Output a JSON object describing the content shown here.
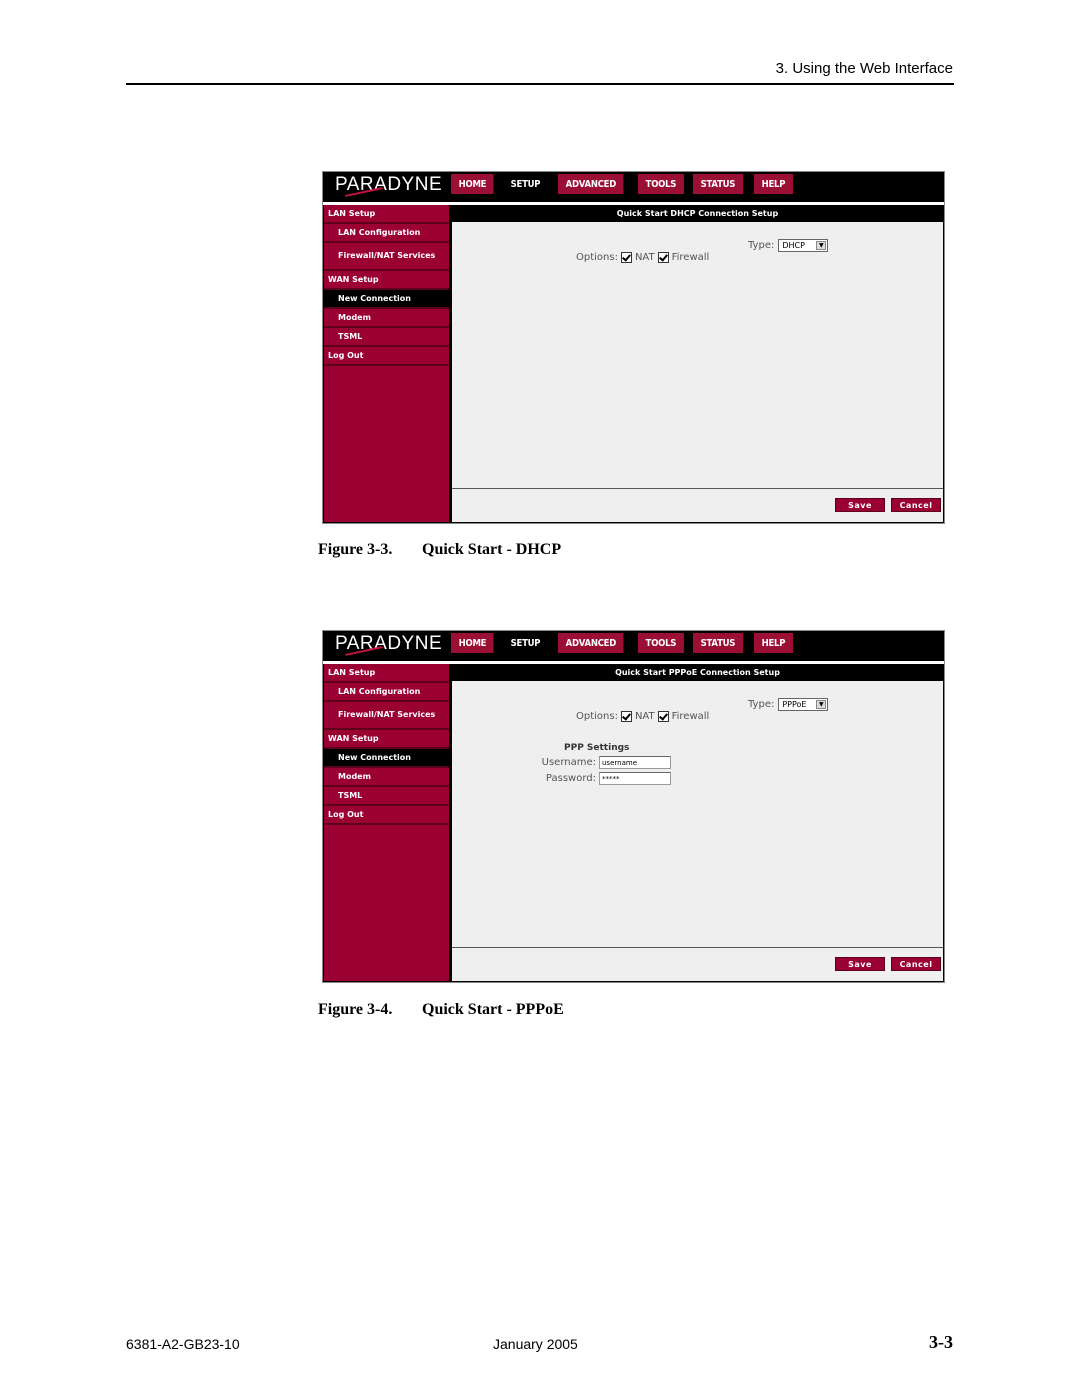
{
  "page": {
    "header": "3. Using the Web Interface",
    "footer_left": "6381-A2-GB23-10",
    "footer_center": "January 2005",
    "footer_right": "3-3"
  },
  "figures": [
    {
      "caption_number": "Figure 3-3.",
      "caption_title": "Quick Start - DHCP",
      "logo": "PARADYNE",
      "tabs": [
        "HOME",
        "SETUP",
        "ADVANCED",
        "TOOLS",
        "STATUS",
        "HELP"
      ],
      "active_tab": "SETUP",
      "sidebar": [
        "LAN Setup",
        "LAN Configuration",
        "Firewall/NAT Services",
        "WAN Setup",
        "New Connection",
        "Modem",
        "TSML",
        "Log Out"
      ],
      "panel_title": "Quick Start DHCP Connection Setup",
      "options_label": "Options:",
      "nat_label": "NAT",
      "firewall_label": "Firewall",
      "type_label": "Type:",
      "type_value": "DHCP",
      "save": "Save",
      "cancel": "Cancel"
    },
    {
      "caption_number": "Figure 3-4.",
      "caption_title": "Quick Start - PPPoE",
      "logo": "PARADYNE",
      "tabs": [
        "HOME",
        "SETUP",
        "ADVANCED",
        "TOOLS",
        "STATUS",
        "HELP"
      ],
      "active_tab": "SETUP",
      "sidebar": [
        "LAN Setup",
        "LAN Configuration",
        "Firewall/NAT Services",
        "WAN Setup",
        "New Connection",
        "Modem",
        "TSML",
        "Log Out"
      ],
      "panel_title": "Quick Start PPPoE Connection Setup",
      "options_label": "Options:",
      "nat_label": "NAT",
      "firewall_label": "Firewall",
      "type_label": "Type:",
      "type_value": "PPPoE",
      "ppp_title": "PPP Settings",
      "username_label": "Username:",
      "username_value": "username",
      "password_label": "Password:",
      "password_value": "*****",
      "save": "Save",
      "cancel": "Cancel"
    }
  ]
}
